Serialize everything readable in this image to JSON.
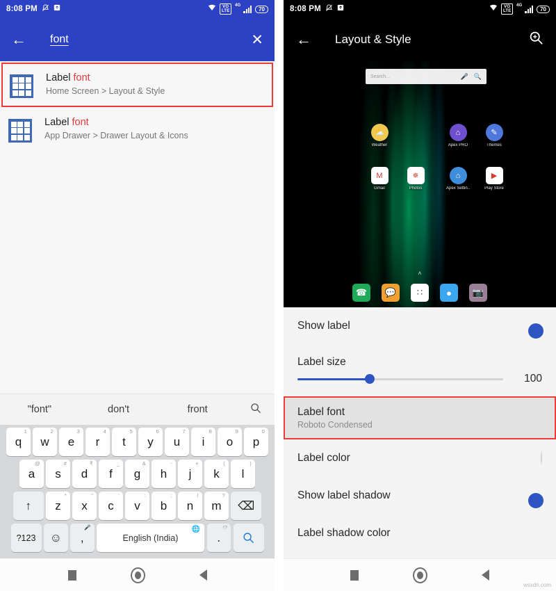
{
  "left_phone": {
    "status_bar": {
      "time": "8:08 PM",
      "mute_icon": "bell-muted-icon",
      "upload_icon": "upload-box-icon",
      "wifi_icon": "wifi-icon",
      "volte_top": "VO",
      "volte_bottom": "LTE",
      "network_type": "4G",
      "battery": "70",
      "bg_color": "#2c41c4"
    },
    "search_bar": {
      "back_icon": "arrow-left-icon",
      "query": "font",
      "clear_icon": "close-icon",
      "bg_color": "#2c41c4"
    },
    "results": [
      {
        "icon": "grid-icon",
        "title_plain": "Label ",
        "title_match": "font",
        "subtitle": "Home Screen > Layout & Style",
        "highlighted": true
      },
      {
        "icon": "grid-icon",
        "title_plain": "Label ",
        "title_match": "font",
        "subtitle": "App Drawer > Drawer Layout & Icons",
        "highlighted": false
      }
    ],
    "keyboard": {
      "suggestions": [
        "\"font\"",
        "don't",
        "front"
      ],
      "suggestion_icon": "search-icon",
      "row1": [
        {
          "key": "q",
          "sup": "1"
        },
        {
          "key": "w",
          "sup": "2"
        },
        {
          "key": "e",
          "sup": "3"
        },
        {
          "key": "r",
          "sup": "4"
        },
        {
          "key": "t",
          "sup": "5"
        },
        {
          "key": "y",
          "sup": "6"
        },
        {
          "key": "u",
          "sup": "7"
        },
        {
          "key": "i",
          "sup": "8"
        },
        {
          "key": "o",
          "sup": "9"
        },
        {
          "key": "p",
          "sup": "0"
        }
      ],
      "row2": [
        {
          "key": "a",
          "sup": "@"
        },
        {
          "key": "s",
          "sup": "#"
        },
        {
          "key": "d",
          "sup": "₹"
        },
        {
          "key": "f",
          "sup": "_"
        },
        {
          "key": "g",
          "sup": "&"
        },
        {
          "key": "h",
          "sup": "-"
        },
        {
          "key": "j",
          "sup": "+"
        },
        {
          "key": "k",
          "sup": "("
        },
        {
          "key": "l",
          "sup": ")"
        }
      ],
      "row3": [
        {
          "key": "z",
          "sup": "*"
        },
        {
          "key": "x",
          "sup": "\""
        },
        {
          "key": "c",
          "sup": "'"
        },
        {
          "key": "v",
          "sup": ":"
        },
        {
          "key": "b",
          "sup": ";"
        },
        {
          "key": "n",
          "sup": "!"
        },
        {
          "key": "m",
          "sup": "?"
        }
      ],
      "shift_key": "↑",
      "backspace_key": "⌫",
      "symbols_key": "?123",
      "emoji_key": "☺",
      "comma_key": ",",
      "mic_sup": "mic-icon",
      "space_key": "English (India)",
      "globe_icon": "globe-icon",
      "period_key": ".",
      "period_sup": "!?",
      "search_key": "search-icon"
    },
    "nav_bar": {
      "recents_icon": "square-recents-icon",
      "home_icon": "circle-home-icon",
      "back_icon": "triangle-back-icon"
    }
  },
  "right_phone": {
    "status_bar": {
      "time": "8:08 PM",
      "mute_icon": "bell-muted-icon",
      "upload_icon": "upload-box-icon",
      "wifi_icon": "wifi-icon",
      "volte_top": "VO",
      "volte_bottom": "LTE",
      "network_type": "4G",
      "battery": "70",
      "bg_color": "#000000"
    },
    "app_bar": {
      "back_icon": "arrow-left-icon",
      "title": "Layout & Style",
      "zoom_icon": "zoom-in-icon"
    },
    "preview": {
      "widget_placeholder": "Search...",
      "widget_mic_icon": "mic-icon",
      "widget_search_icon": "search-icon",
      "row1_apps": [
        {
          "name": "Weather",
          "icon": "weather-icon",
          "color": "#f0c850",
          "glyph": "⛅",
          "shape": "round"
        },
        {
          "name": "Apex PRO",
          "icon": "apex-pro-icon",
          "color": "#6f4ecf",
          "glyph": "⌂",
          "shape": "round"
        },
        {
          "name": "Themes",
          "icon": "themes-icon",
          "color": "#4f78dd",
          "glyph": "✎",
          "shape": "round"
        }
      ],
      "row2_apps": [
        {
          "name": "Gmail",
          "icon": "gmail-icon",
          "color": "#ffffff",
          "glyph": "M",
          "shape": "square"
        },
        {
          "name": "Photos",
          "icon": "photos-icon",
          "color": "#ffffff",
          "glyph": "✵",
          "shape": "square"
        },
        {
          "name": "Apex Settin..",
          "icon": "apex-settings-icon",
          "color": "#3f8edb",
          "glyph": "⌂",
          "shape": "round"
        },
        {
          "name": "Play Store",
          "icon": "play-store-icon",
          "color": "#ffffff",
          "glyph": "▶",
          "shape": "square"
        }
      ],
      "dock_apps": [
        {
          "icon": "phone-icon",
          "color": "#1faa5a",
          "glyph": "☎"
        },
        {
          "icon": "messages-icon",
          "color": "#f0a030",
          "glyph": "💬"
        },
        {
          "icon": "app-drawer-icon",
          "color": "#ffffff",
          "glyph": "∷"
        },
        {
          "icon": "browser-icon",
          "color": "#3aa7f0",
          "glyph": "●"
        },
        {
          "icon": "camera-icon",
          "color": "#9a7f96",
          "glyph": "📷"
        }
      ],
      "drawer_arrow": "˄"
    },
    "settings": [
      {
        "label": "Show label",
        "control": "toggle",
        "value": "on"
      },
      {
        "label": "Label size",
        "control": "slider",
        "value": "100",
        "percent": 35
      },
      {
        "label": "Label font",
        "sub": "Roboto Condensed",
        "control": "none",
        "highlighted": true
      },
      {
        "label": "Label color",
        "control": "swatch",
        "swatch": "#ffffff"
      },
      {
        "label": "Show label shadow",
        "control": "toggle",
        "value": "on"
      },
      {
        "label": "Label shadow color",
        "control": "swatch",
        "swatch": "#000000"
      }
    ],
    "nav_bar": {
      "recents_icon": "square-recents-icon",
      "home_icon": "circle-home-icon",
      "back_icon": "triangle-back-icon"
    }
  },
  "watermark": "wsxdn.com"
}
